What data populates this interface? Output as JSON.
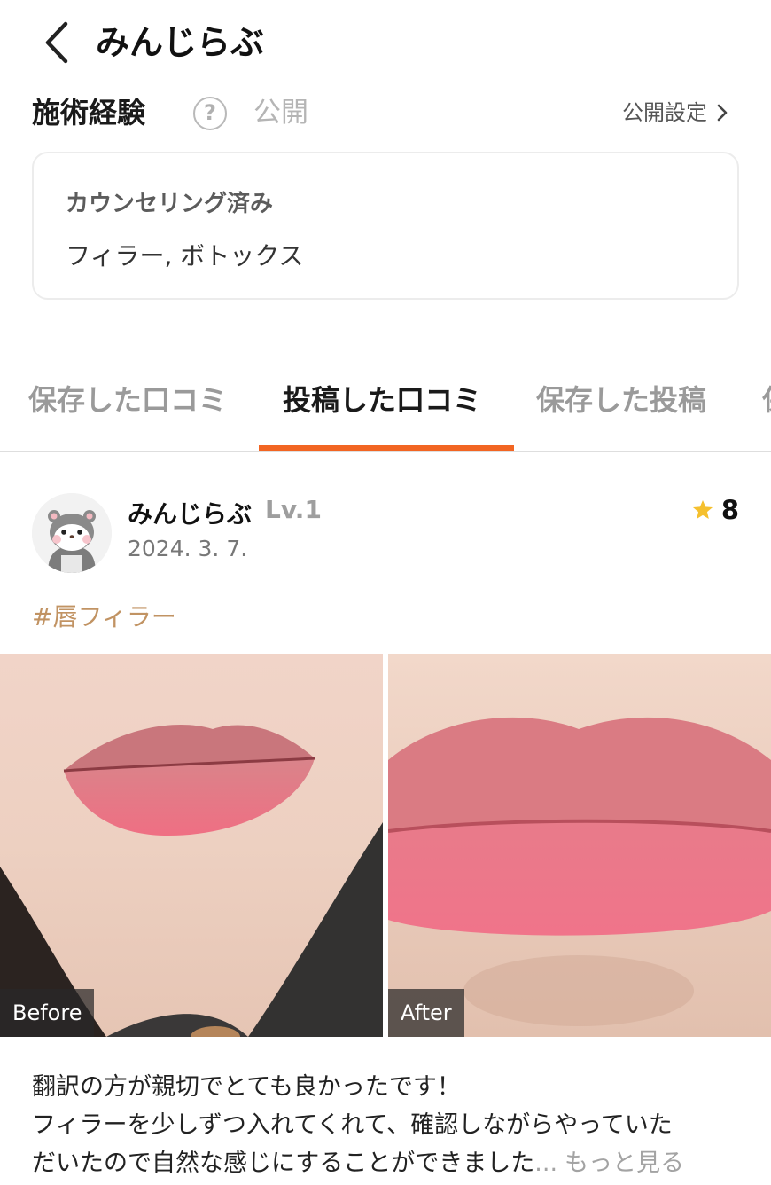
{
  "header": {
    "title": "みんじらぶ"
  },
  "experience": {
    "title": "施術経験",
    "help_symbol": "?",
    "visibility": "公開",
    "settings_label": "公開設定",
    "status": "カウンセリング済み",
    "treatments": "フィラー, ボトックス"
  },
  "tabs": [
    {
      "label": "保存した口コミ",
      "active": false
    },
    {
      "label": "投稿した口コミ",
      "active": true
    },
    {
      "label": "保存した投稿",
      "active": false
    },
    {
      "label": "保存した施術",
      "active": false
    }
  ],
  "colors": {
    "accent": "#f26522",
    "hashtag": "#c19363",
    "star": "#f5c02e"
  },
  "review": {
    "user_name": "みんじらぶ",
    "level": "Lv.1",
    "date": "2024. 3. 7.",
    "rating": "8",
    "hashtag": "#唇フィラー",
    "photos": [
      {
        "label": "Before"
      },
      {
        "label": "After"
      }
    ],
    "text_line1": "翻訳の方が親切でとても良かったです！",
    "text_line2": "フィラーを少しずつ入れてくれて、確認しながらやっていた",
    "text_line3": "だいたので自然な感じにすることができました",
    "ellipsis": "...",
    "more_label": "もっと見る"
  }
}
